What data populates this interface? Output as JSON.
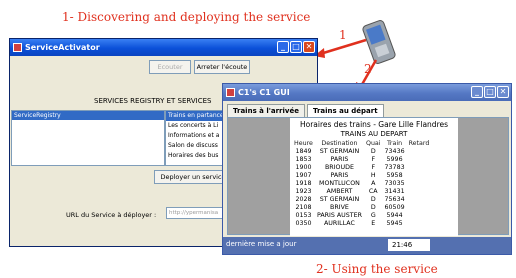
{
  "captions": {
    "top": "1- Discovering and deploying the service",
    "bottom": "2- Using the service",
    "step1": "1",
    "step2": "2"
  },
  "colors": {
    "caption": "#e0301e",
    "titlebar": "#0b50d8",
    "selection": "#316ac5"
  },
  "activator": {
    "title": "ServiceActivator",
    "btn_listen": "Ecouter",
    "btn_stop": "Arreter l'écoute",
    "registry_title": "SERVICES REGISTRY ET SERVICES",
    "registry_item": "ServiceRegistry",
    "services": [
      "Trains en partance",
      "Les concerts à Li",
      "Informations et a",
      "Salon de discuss",
      "Horaires des bus"
    ],
    "btn_deploy": "Deployer un service",
    "url_label": "URL du Service à déployer :",
    "url_value": "http://ypermanisa"
  },
  "gui": {
    "title": "C1's C1 GUI",
    "tabs": [
      "Trains à l'arrivée",
      "Trains au départ"
    ],
    "board_title": "Horaires des trains - Gare Lille Flandres",
    "board_subtitle": "TRAINS AU DEPART",
    "columns": [
      "Heure",
      "Destination",
      "Quai",
      "Train",
      "Retard"
    ],
    "rows": [
      [
        "1849",
        "ST GERMAIN",
        "D",
        "73436",
        ""
      ],
      [
        "1853",
        "PARIS",
        "F",
        "5996",
        ""
      ],
      [
        "1900",
        "BRIOUDE",
        "F",
        "73783",
        ""
      ],
      [
        "1907",
        "PARIS",
        "H",
        "5958",
        ""
      ],
      [
        "1918",
        "MONTLUCON",
        "A",
        "73035",
        ""
      ],
      [
        "1923",
        "AMBERT",
        "CA",
        "31431",
        ""
      ],
      [
        "2028",
        "ST GERMAIN",
        "D",
        "75634",
        ""
      ],
      [
        "2108",
        "BRIVE",
        "D",
        "60509",
        ""
      ],
      [
        "0153",
        "PARIS AUSTER",
        "G",
        "5944",
        ""
      ],
      [
        "0350",
        "AURILLAC",
        "E",
        "5945",
        ""
      ]
    ],
    "status_label": "dernière mise a jour",
    "status_time": "21:46"
  }
}
